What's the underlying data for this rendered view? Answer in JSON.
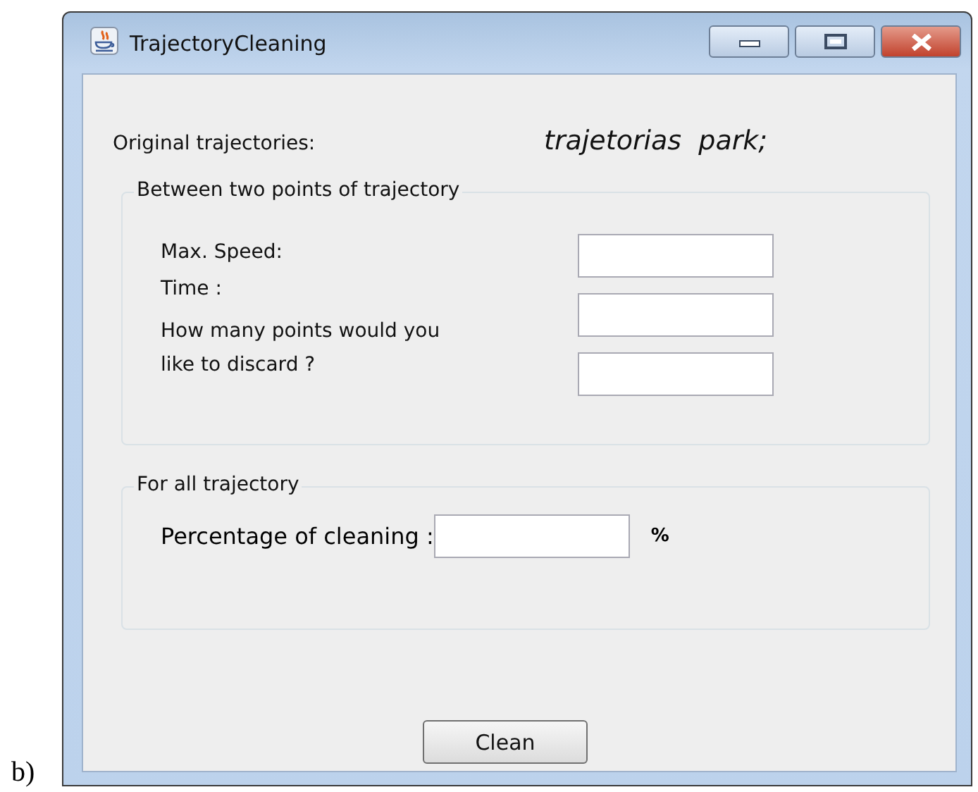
{
  "figure_label": "b)",
  "window": {
    "title": "TrajectoryCleaning",
    "controls": [
      {
        "kind": "minimize"
      },
      {
        "kind": "maximize"
      },
      {
        "kind": "close"
      }
    ]
  },
  "header": {
    "label": "Original trajectories:",
    "value": "trajetorias  park;"
  },
  "groups": [
    {
      "title": "Between two points of trajectory",
      "fields": [
        {
          "label": "Max. Speed:"
        },
        {
          "label": "Time :"
        },
        {
          "label": "How many points would you like to discard ?"
        }
      ]
    },
    {
      "title": "For all trajectory",
      "fields": [
        {
          "label": "Percentage of cleaning :",
          "unit": "%"
        }
      ]
    }
  ],
  "buttons": [
    {
      "label": "Clean"
    }
  ]
}
